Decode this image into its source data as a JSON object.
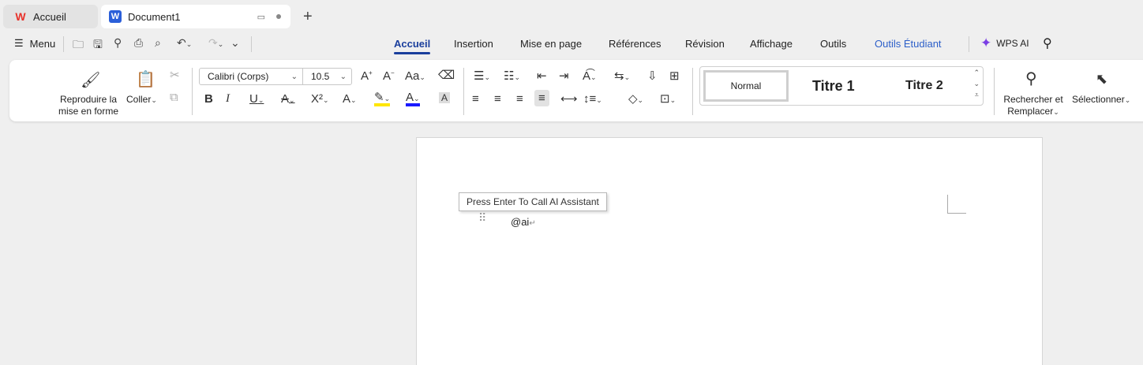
{
  "tabs": [
    {
      "label": "Accueil",
      "icon": "wps-logo-icon"
    },
    {
      "label": "Document1",
      "icon": "word-doc-icon"
    }
  ],
  "menu": {
    "label": "Menu"
  },
  "nav_tabs": [
    "Accueil",
    "Insertion",
    "Mise en page",
    "Références",
    "Révision",
    "Affichage",
    "Outils",
    "Outils Étudiant"
  ],
  "wps_ai": {
    "label": "WPS AI"
  },
  "ribbon": {
    "format_painter": {
      "line1": "Reproduire la",
      "line2": "mise en forme"
    },
    "paste": {
      "label": "Coller"
    },
    "font": {
      "value": "Calibri (Corps)"
    },
    "size": {
      "value": "10.5"
    },
    "styles": {
      "normal": "Normal",
      "title1": "Titre 1",
      "title2": "Titre 2"
    },
    "find": {
      "line1": "Rechercher et",
      "line2": "Remplacer"
    },
    "select": {
      "label": "Sélectionner"
    }
  },
  "document": {
    "tooltip": "Press Enter To Call AI Assistant",
    "typed_text": "@ai"
  },
  "colors": {
    "accent": "#1a3e9c",
    "highlight": "#ffe600",
    "font_color": "#1a1aff"
  }
}
